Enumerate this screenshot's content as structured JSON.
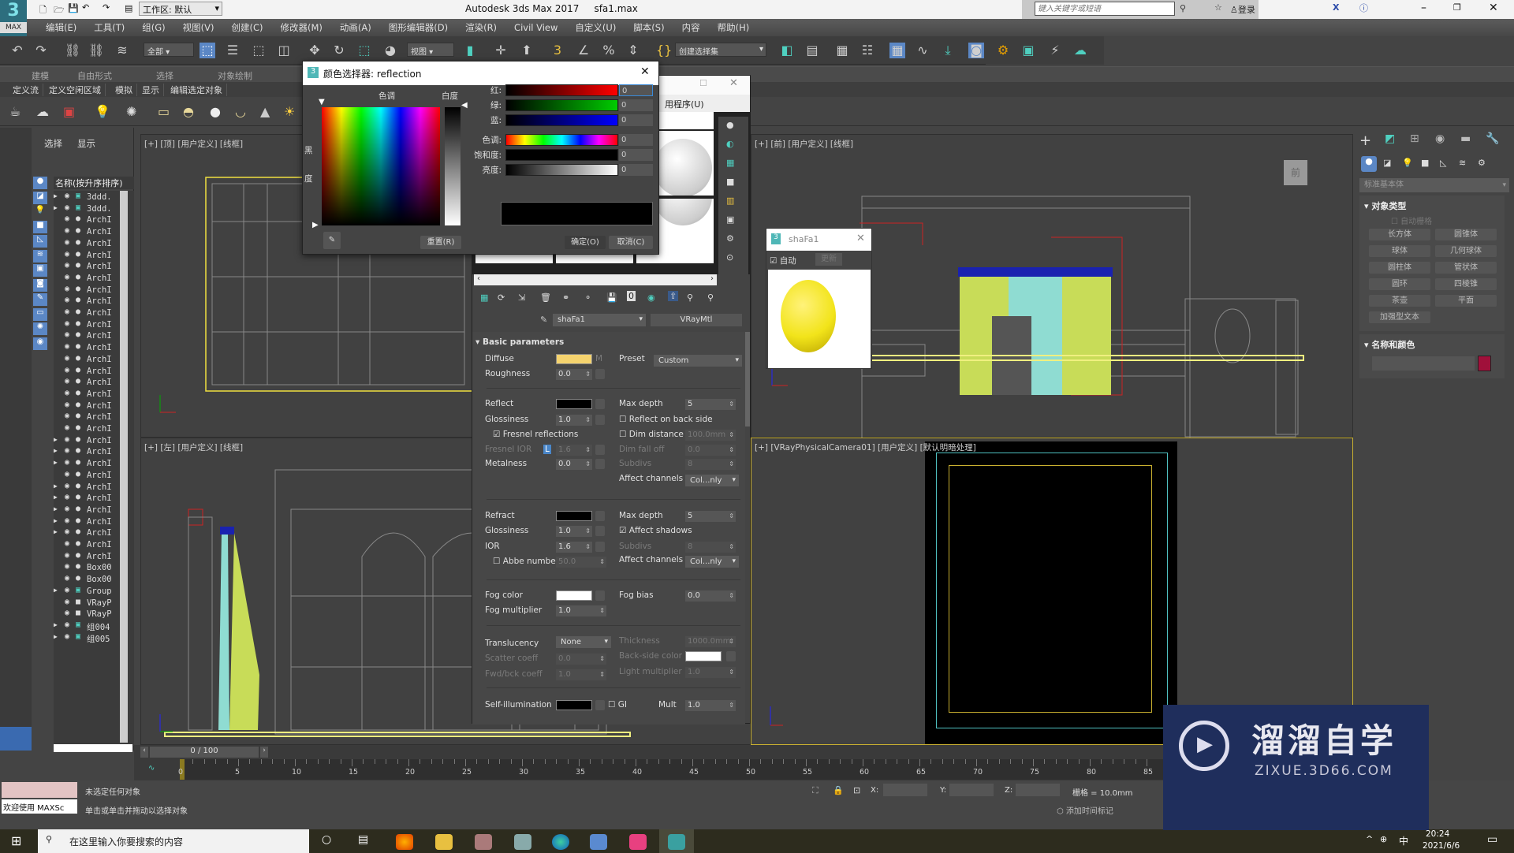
{
  "app": {
    "title": "Autodesk 3ds Max 2017",
    "file": "sfa1.max",
    "workspace": "工作区: 默认",
    "search_placeholder": "键入关键字或短语",
    "login": "登录",
    "logo_label": "MAX"
  },
  "menu": [
    "编辑(E)",
    "工具(T)",
    "组(G)",
    "视图(V)",
    "创建(C)",
    "修改器(M)",
    "动画(A)",
    "图形编辑器(D)",
    "渲染(R)",
    "Civil View",
    "自定义(U)",
    "脚本(S)",
    "内容",
    "帮助(H)"
  ],
  "toolbar": {
    "filter": "全部",
    "ref_coord": "视图",
    "selection_set": "创建选择集"
  },
  "ribbon": {
    "tabs": [
      "建模",
      "自由形式",
      "选择",
      "对象绘制"
    ],
    "sub_tabs": [
      "定义流",
      "定义空闲区域",
      "模拟",
      "显示",
      "编辑选定对象"
    ]
  },
  "explorer": {
    "tabs": [
      "选择",
      "显示"
    ],
    "column": "名称(按升序排序)",
    "items": [
      {
        "name": "3ddd.",
        "expand": true,
        "type": "group"
      },
      {
        "name": "3ddd.",
        "expand": true,
        "type": "group"
      },
      {
        "name": "ArchI",
        "expand": false,
        "type": "geo"
      },
      {
        "name": "ArchI",
        "expand": false,
        "type": "geo"
      },
      {
        "name": "ArchI",
        "expand": false,
        "type": "geo"
      },
      {
        "name": "ArchI",
        "expand": false,
        "type": "geo"
      },
      {
        "name": "ArchI",
        "expand": false,
        "type": "geo"
      },
      {
        "name": "ArchI",
        "expand": false,
        "type": "geo"
      },
      {
        "name": "ArchI",
        "expand": false,
        "type": "geo"
      },
      {
        "name": "ArchI",
        "expand": false,
        "type": "geo"
      },
      {
        "name": "ArchI",
        "expand": false,
        "type": "geo"
      },
      {
        "name": "ArchI",
        "expand": false,
        "type": "geo"
      },
      {
        "name": "ArchI",
        "expand": false,
        "type": "geo"
      },
      {
        "name": "ArchI",
        "expand": false,
        "type": "geo"
      },
      {
        "name": "ArchI",
        "expand": false,
        "type": "geo"
      },
      {
        "name": "ArchI",
        "expand": false,
        "type": "geo"
      },
      {
        "name": "ArchI",
        "expand": false,
        "type": "geo"
      },
      {
        "name": "ArchI",
        "expand": false,
        "type": "geo"
      },
      {
        "name": "ArchI",
        "expand": false,
        "type": "geo"
      },
      {
        "name": "ArchI",
        "expand": false,
        "type": "geo"
      },
      {
        "name": "ArchI",
        "expand": false,
        "type": "geo"
      },
      {
        "name": "ArchI",
        "expand": true,
        "type": "geo"
      },
      {
        "name": "ArchI",
        "expand": true,
        "type": "geo"
      },
      {
        "name": "ArchI",
        "expand": true,
        "type": "geo"
      },
      {
        "name": "ArchI",
        "expand": false,
        "type": "geo"
      },
      {
        "name": "ArchI",
        "expand": true,
        "type": "geo"
      },
      {
        "name": "ArchI",
        "expand": true,
        "type": "geo"
      },
      {
        "name": "ArchI",
        "expand": true,
        "type": "geo"
      },
      {
        "name": "ArchI",
        "expand": true,
        "type": "geo"
      },
      {
        "name": "ArchI",
        "expand": true,
        "type": "geo"
      },
      {
        "name": "ArchI",
        "expand": false,
        "type": "geo"
      },
      {
        "name": "ArchI",
        "expand": false,
        "type": "geo"
      },
      {
        "name": "Box00",
        "expand": false,
        "type": "geo"
      },
      {
        "name": "Box00",
        "expand": false,
        "type": "geo"
      },
      {
        "name": "Group",
        "expand": true,
        "type": "group"
      },
      {
        "name": "VRayP",
        "expand": false,
        "type": "camera"
      },
      {
        "name": "VRayP",
        "expand": false,
        "type": "camera"
      },
      {
        "name": "组004",
        "expand": true,
        "type": "group"
      },
      {
        "name": "组005",
        "expand": true,
        "type": "group"
      }
    ]
  },
  "viewports": {
    "top": "[+] [顶] [用户定义] [线框]",
    "front": "[+] [前] [用户定义] [线框]",
    "left": "[+] [左] [用户定义] [线框]",
    "camera": "[+] [VRayPhysicalCamera01] [用户定义] [默认明暗处理]",
    "viewcube_label": "前"
  },
  "color_picker": {
    "title": "颜色选择器: reflection",
    "hue_label": "色调",
    "whiteness_label": "白度",
    "blackness_label": "黑 度",
    "rows": [
      {
        "label": "红:",
        "value": "0"
      },
      {
        "label": "绿:",
        "value": "0"
      },
      {
        "label": "蓝:",
        "value": "0"
      },
      {
        "label": "色调:",
        "value": "0"
      },
      {
        "label": "饱和度:",
        "value": "0"
      },
      {
        "label": "亮度:",
        "value": "0"
      }
    ],
    "reset": "重置(R)",
    "ok": "确定(O)",
    "cancel": "取消(C)",
    "current_color": "#000000"
  },
  "material_editor": {
    "menu_fragment": "用程序(U)",
    "material_name": "shaFa1",
    "material_type": "VRayMtl",
    "rollout": "Basic parameters",
    "diffuse": {
      "label": "Diffuse",
      "color": "#f5d36e",
      "map": "M"
    },
    "roughness": {
      "label": "Roughness",
      "value": "0.0"
    },
    "preset": {
      "label": "Preset",
      "value": "Custom"
    },
    "reflect": {
      "label": "Reflect",
      "color": "#000000"
    },
    "refl_glossiness": {
      "label": "Glossiness",
      "value": "1.0"
    },
    "fresnel": {
      "label": "Fresnel reflections",
      "checked": true
    },
    "fresnel_ior": {
      "label": "Fresnel IOR",
      "lock": "L",
      "value": "1.6"
    },
    "metalness": {
      "label": "Metalness",
      "value": "0.0"
    },
    "refl_max_depth": {
      "label": "Max depth",
      "value": "5"
    },
    "reflect_back": {
      "label": "Reflect on back side",
      "checked": false
    },
    "dim_distance": {
      "label": "Dim distance",
      "checked": false,
      "value": "100.0mm"
    },
    "dim_falloff": {
      "label": "Dim fall off",
      "value": "0.0"
    },
    "refl_subdivs": {
      "label": "Subdivs",
      "value": "8"
    },
    "refl_affect": {
      "label": "Affect channels",
      "value": "Col...nly"
    },
    "refract": {
      "label": "Refract",
      "color": "#000000"
    },
    "refr_glossiness": {
      "label": "Glossiness",
      "value": "1.0"
    },
    "ior": {
      "label": "IOR",
      "value": "1.6"
    },
    "abbe": {
      "label": "Abbe number",
      "checked": false,
      "value": "50.0"
    },
    "refr_max_depth": {
      "label": "Max depth",
      "value": "5"
    },
    "affect_shadows": {
      "label": "Affect shadows",
      "checked": true
    },
    "refr_subdivs": {
      "label": "Subdivs",
      "value": "8"
    },
    "refr_affect": {
      "label": "Affect channels",
      "value": "Col...nly"
    },
    "fog_color": {
      "label": "Fog color",
      "color": "#ffffff"
    },
    "fog_multiplier": {
      "label": "Fog multiplier",
      "value": "1.0"
    },
    "fog_bias": {
      "label": "Fog bias",
      "value": "0.0"
    },
    "translucency": {
      "label": "Translucency",
      "value": "None"
    },
    "scatter": {
      "label": "Scatter coeff",
      "value": "0.0"
    },
    "fwd_bck": {
      "label": "Fwd/bck coeff",
      "value": "1.0"
    },
    "thickness": {
      "label": "Thickness",
      "value": "1000.0mm"
    },
    "backside_color": {
      "label": "Back-side color",
      "color": "#ffffff"
    },
    "light_mult": {
      "label": "Light multiplier",
      "value": "1.0"
    },
    "self_illum": {
      "label": "Self-illumination",
      "color": "#000000"
    },
    "gi": {
      "label": "GI",
      "checked": false
    },
    "mult": {
      "label": "Mult",
      "value": "1.0"
    }
  },
  "preview_window": {
    "title": "shaFa1",
    "auto": "自动",
    "auto_checked": true,
    "update": "更新",
    "sphere_color": "#f2e41a"
  },
  "command_panel": {
    "category": "标准基本体",
    "object_type": "对象类型",
    "autogrid": "自动栅格",
    "buttons": [
      "长方体",
      "圆锥体",
      "球体",
      "几何球体",
      "圆柱体",
      "管状体",
      "圆环",
      "四棱锥",
      "茶壶",
      "平面",
      "加强型文本"
    ],
    "name_color": "名称和颜色",
    "object_color": "#a0103a"
  },
  "timeline": {
    "frame": "0 / 100",
    "ticks": [
      "0",
      "5",
      "10",
      "15",
      "20",
      "25",
      "30",
      "35",
      "40",
      "45",
      "50",
      "55",
      "60",
      "65",
      "70",
      "75",
      "80",
      "85"
    ]
  },
  "status": {
    "maxscript": "欢迎使用 MAXSc",
    "selection": "未选定任何对象",
    "prompt": "单击或单击并拖动以选择对象",
    "x_label": "X:",
    "y_label": "Y:",
    "z_label": "Z:",
    "grid": "栅格 = 10.0mm",
    "add_time_tag": "添加时间标记"
  },
  "taskbar": {
    "search": "在这里输入你要搜索的内容",
    "time": "20:24",
    "date": "2021/6/6",
    "ime": "中"
  },
  "watermark": {
    "brand": "溜溜自学",
    "url": "ZIXUE.3D66.COM"
  }
}
